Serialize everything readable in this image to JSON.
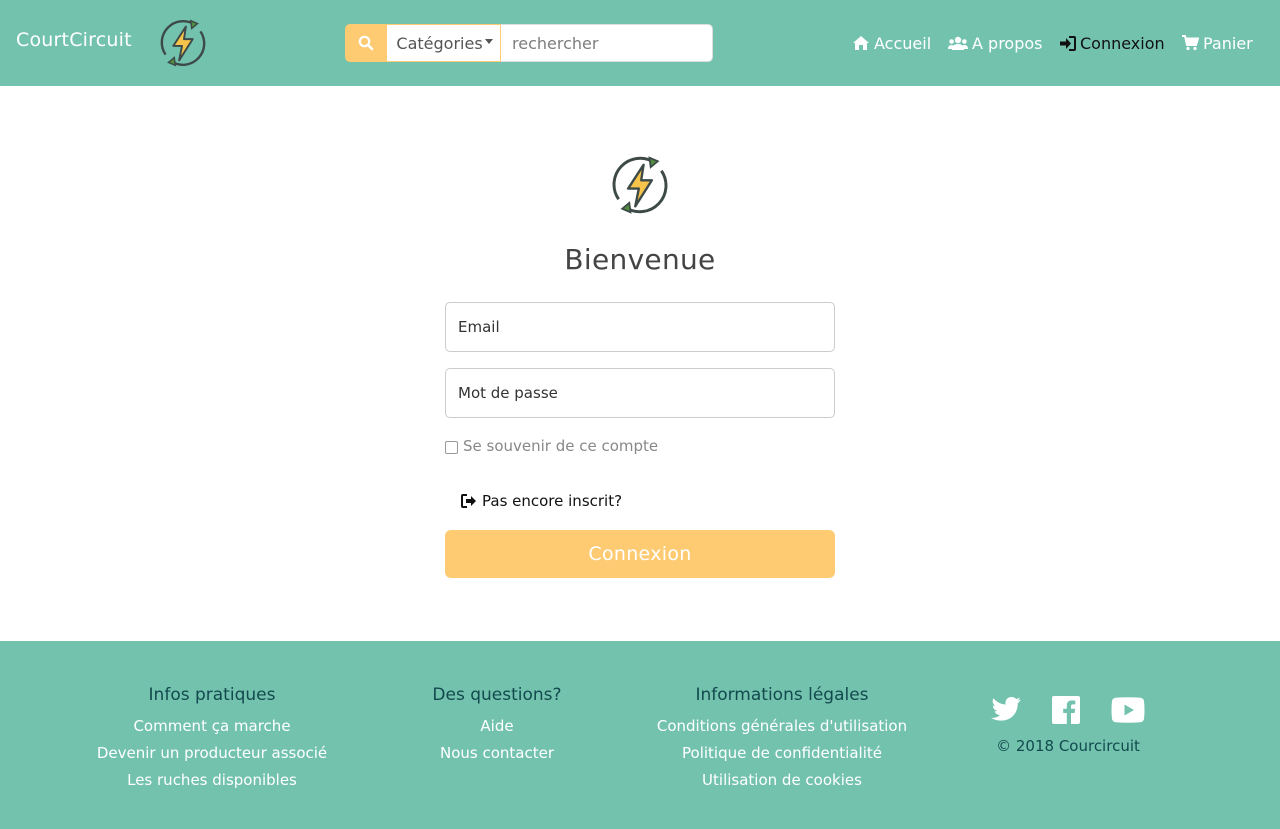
{
  "header": {
    "brand": "CourtCircuit",
    "search": {
      "category_label": "Catégories",
      "placeholder": "rechercher"
    },
    "nav": [
      {
        "label": "Accueil",
        "icon": "home-icon"
      },
      {
        "label": "A propos",
        "icon": "users-icon"
      },
      {
        "label": "Connexion",
        "icon": "sign-in-icon"
      },
      {
        "label": "Panier",
        "icon": "cart-icon"
      }
    ]
  },
  "main": {
    "title": "Bienvenue",
    "email_placeholder": "Email",
    "password_placeholder": "Mot de passe",
    "remember_label": "Se souvenir de ce compte",
    "signup_label": "Pas encore inscrit?",
    "submit_label": "Connexion"
  },
  "footer": {
    "columns": [
      {
        "title": "Infos pratiques",
        "links": [
          "Comment ça marche",
          "Devenir un producteur associé",
          "Les ruches disponibles"
        ]
      },
      {
        "title": "Des questions?",
        "links": [
          "Aide",
          "Nous contacter"
        ]
      },
      {
        "title": "Informations légales",
        "links": [
          "Conditions générales d'utilisation",
          "Politique de confidentialité",
          "Utilisation de cookies"
        ]
      }
    ],
    "social": [
      "twitter-icon",
      "facebook-icon",
      "youtube-icon"
    ],
    "copyright": "© 2018 Courcircuit"
  },
  "colors": {
    "header_bg": "#73c2ae",
    "footer_bg": "#73c2ae",
    "accent_yellow": "#fecb72",
    "footer_heading": "#124a4e"
  }
}
